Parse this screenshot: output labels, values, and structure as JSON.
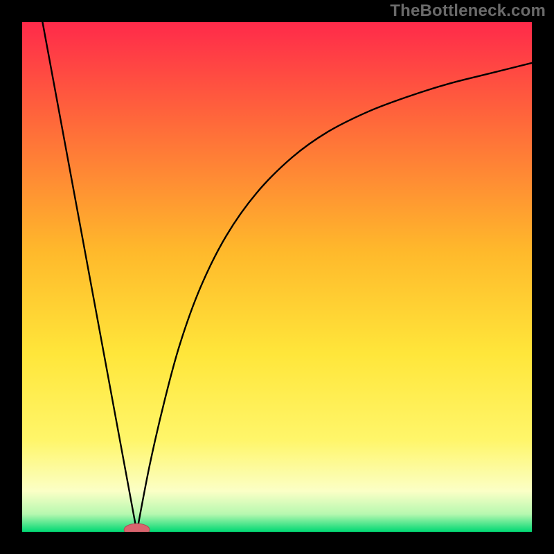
{
  "watermark": "TheBottleneck.com",
  "colors": {
    "bg": "#000000",
    "gradient_top": "#ff2a4a",
    "gradient_mid1": "#ff8b2b",
    "gradient_mid2": "#ffd22b",
    "gradient_mid3": "#fff35a",
    "gradient_bottom_yellow": "#fdffc0",
    "gradient_green": "#00d873",
    "curve": "#000000",
    "marker_fill": "#d9646e",
    "marker_stroke": "#b24a55"
  },
  "chart_data": {
    "type": "line",
    "title": "",
    "xlabel": "",
    "ylabel": "",
    "xlim": [
      0,
      100
    ],
    "ylim": [
      0,
      100
    ],
    "series": [
      {
        "name": "left-line",
        "x": [
          4,
          22.5
        ],
        "values": [
          100,
          0
        ]
      },
      {
        "name": "right-curve",
        "x": [
          22.5,
          25,
          28,
          31,
          35,
          40,
          46,
          53,
          60,
          68,
          76,
          84,
          92,
          100
        ],
        "values": [
          0,
          13,
          26,
          37,
          48,
          58,
          66.5,
          73.5,
          78.5,
          82.5,
          85.5,
          88,
          90,
          92
        ]
      }
    ],
    "marker": {
      "x": 22.5,
      "y": 0,
      "rx": 2.5,
      "ry": 1.2
    },
    "gradient_stops": [
      {
        "offset": 0.0,
        "color": "#ff2a4a"
      },
      {
        "offset": 0.2,
        "color": "#ff6a3a"
      },
      {
        "offset": 0.45,
        "color": "#ffb92b"
      },
      {
        "offset": 0.65,
        "color": "#ffe63a"
      },
      {
        "offset": 0.82,
        "color": "#fff66a"
      },
      {
        "offset": 0.92,
        "color": "#fbffc6"
      },
      {
        "offset": 0.965,
        "color": "#b7f8b0"
      },
      {
        "offset": 1.0,
        "color": "#00d873"
      }
    ]
  }
}
